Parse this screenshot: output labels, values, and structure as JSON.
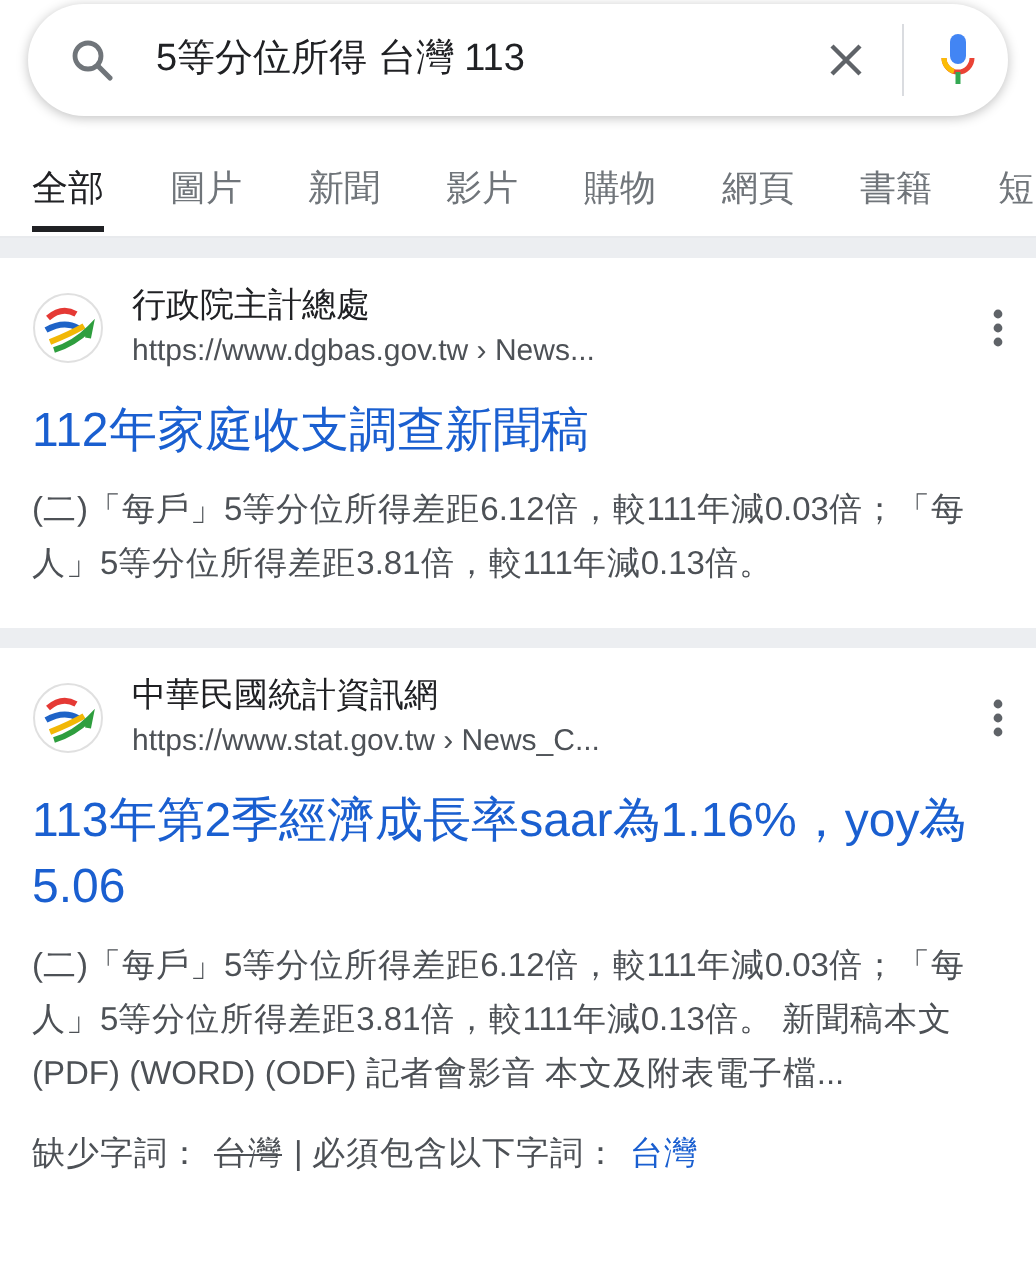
{
  "search": {
    "value": "5等分位所得 台灣 113"
  },
  "tabs": [
    {
      "label": "全部",
      "selected": true
    },
    {
      "label": "圖片",
      "selected": false
    },
    {
      "label": "新聞",
      "selected": false
    },
    {
      "label": "影片",
      "selected": false
    },
    {
      "label": "購物",
      "selected": false
    },
    {
      "label": "網頁",
      "selected": false
    },
    {
      "label": "書籍",
      "selected": false
    },
    {
      "label": "短",
      "selected": false
    }
  ],
  "results": [
    {
      "site": "行政院主計總處",
      "url": "https://www.dgbas.gov.tw › News...",
      "title": "112年家庭收支調查新聞稿",
      "snippet": "(二)「每戶」5等分位所得差距6.12倍，較111年減0.03倍；「每人」5等分位所得差距3.81倍，較111年減0.13倍。"
    },
    {
      "site": "中華民國統計資訊網",
      "url": "https://www.stat.gov.tw › News_C...",
      "title": "113年第2季經濟成長率saar為1.16%，yoy為5.06",
      "snippet": "(二)「每戶」5等分位所得差距6.12倍，較111年減0.03倍；「每人」5等分位所得差距3.81倍，較111年減0.13倍。 新聞稿本文(PDF) (WORD) (ODF) 記者會影音 本文及附表電子檔...",
      "missing": {
        "label": "缺少字詞：",
        "missing_term": "台灣",
        "require_label": "| 必須包含以下字詞：",
        "require_link": "台灣"
      }
    }
  ]
}
